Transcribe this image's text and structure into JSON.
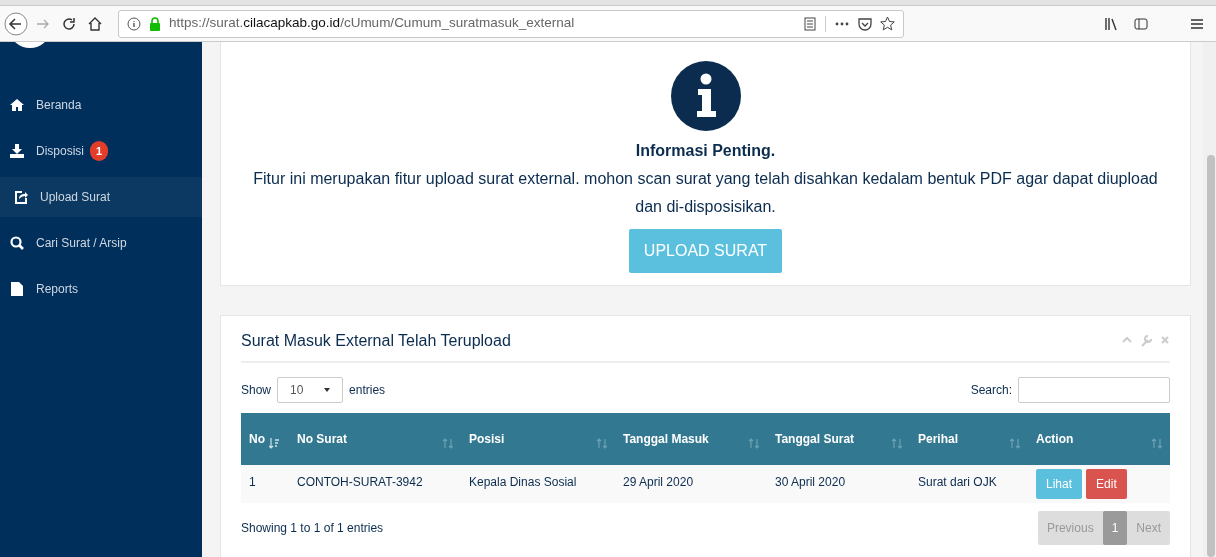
{
  "browser": {
    "url": "https://surat.**cilacapkab.go.id**/cUmum/Cumum_suratmasuk_external"
  },
  "sidebar": {
    "items": [
      {
        "label": "Beranda",
        "kind": "home",
        "selected": false
      },
      {
        "label": "Disposisi",
        "kind": "download",
        "selected": false,
        "badge": "1"
      },
      {
        "label": "Upload Surat",
        "kind": "share",
        "selected": true
      },
      {
        "label": "Cari Surat / Arsip",
        "kind": "search",
        "selected": false
      },
      {
        "label": "Reports",
        "kind": "file",
        "selected": false
      }
    ]
  },
  "info_card": {
    "title": "Informasi Penting.",
    "message": "Fitur ini merupakan fitur upload surat external. mohon scan surat yang telah disahkan kedalam bentuk PDF agar dapat diupload dan di-disposisikan.",
    "button": "UPLOAD SURAT"
  },
  "table_card": {
    "title": "Surat Masuk External Telah Terupload",
    "length": {
      "label_before": "Show",
      "value": "10",
      "label_after": "entries"
    },
    "search": {
      "label": "Search:"
    },
    "table": {
      "columns": [
        {
          "label": "No",
          "sorted": true
        },
        {
          "label": "No Surat",
          "sorted": false
        },
        {
          "label": "Posisi",
          "sorted": false
        },
        {
          "label": "Tanggal Masuk",
          "sorted": false
        },
        {
          "label": "Tanggal Surat",
          "sorted": false
        },
        {
          "label": "Perihal",
          "sorted": false
        },
        {
          "label": "Action",
          "sorted": false
        }
      ],
      "rows": [
        {
          "cells": [
            "1",
            "CONTOH-SURAT-3942",
            "Kepala Dinas Sosial",
            "29 April 2020",
            "30 April 2020",
            "Surat dari OJK"
          ],
          "actions": [
            {
              "label": "Lihat",
              "kind": "info"
            },
            {
              "label": "Edit",
              "kind": "danger"
            }
          ]
        }
      ]
    },
    "info": "Showing 1 to 1 of 1 entries",
    "pagination": [
      {
        "label": "Previous",
        "selected": false,
        "disabled": true
      },
      {
        "label": "1",
        "selected": true,
        "disabled": false
      },
      {
        "label": "Next",
        "selected": false,
        "disabled": true
      }
    ]
  }
}
